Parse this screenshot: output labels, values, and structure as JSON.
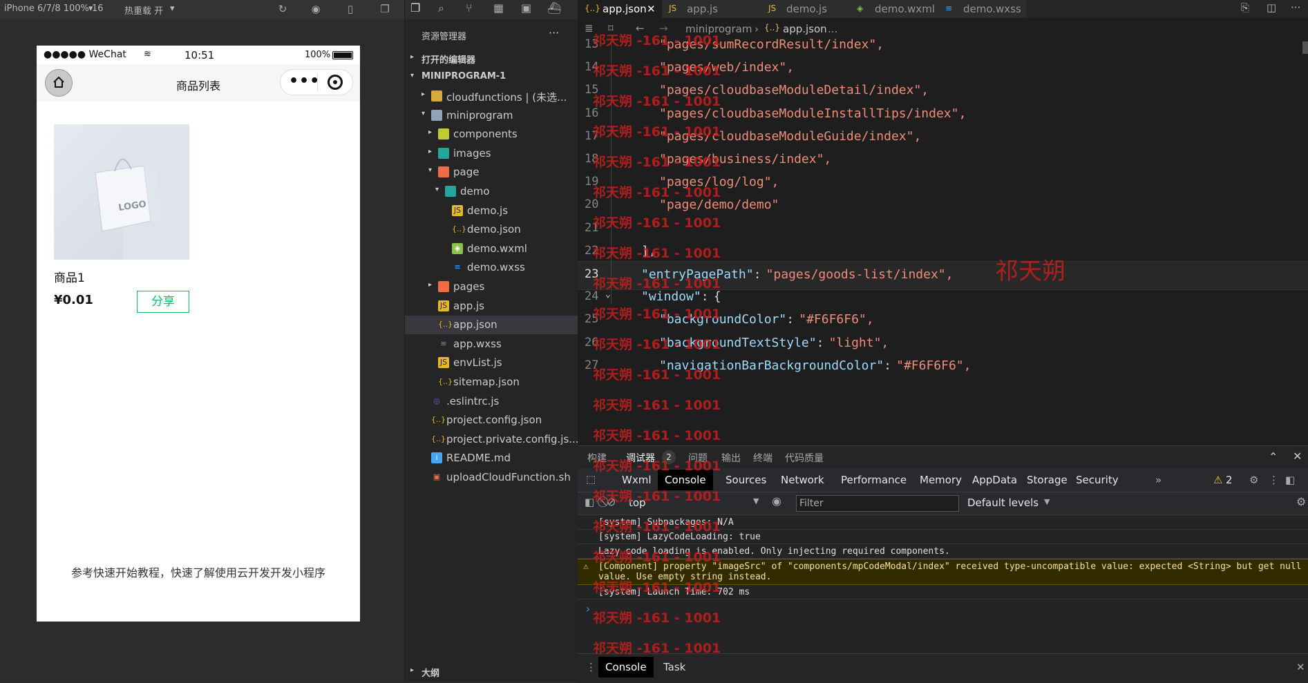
{
  "simulator_toolbar": {
    "device": "iPhone 6/7/8 100% 16",
    "hot_reload": "热重载 开"
  },
  "phone": {
    "carrier": "●●●●● WeChat",
    "time": "10:51",
    "battery": "100%",
    "nav_title": "商品列表",
    "capsule_dots": "•••",
    "product_name": "商品1",
    "product_price": "¥0.01",
    "share_label": "分享",
    "tip_text": "参考快速开始教程，快速了解使用云开发开发小程序",
    "logo_text": "LOGO"
  },
  "explorer": {
    "title": "资源管理器",
    "more": "···",
    "open_editors": "打开的编辑器",
    "project": "MINIPROGRAM-1",
    "outline": "大纲",
    "items": [
      {
        "label": "cloudfunctions | (未选...",
        "arrow": "▸",
        "icon": "folder-icon"
      },
      {
        "label": "miniprogram",
        "arrow": "▾",
        "icon": "folder-open-icon"
      },
      {
        "label": "components",
        "arrow": "▸",
        "icon": "folder-components-icon"
      },
      {
        "label": "images",
        "arrow": "▸",
        "icon": "folder-images-icon"
      },
      {
        "label": "page",
        "arrow": "▾",
        "icon": "folder-page-icon"
      },
      {
        "label": "demo",
        "arrow": "▾",
        "icon": "folder-demo-icon"
      },
      {
        "label": "demo.js",
        "arrow": "",
        "icon": "js-file-icon"
      },
      {
        "label": "demo.json",
        "arrow": "",
        "icon": "json-file-icon"
      },
      {
        "label": "demo.wxml",
        "arrow": "",
        "icon": "wxml-file-icon"
      },
      {
        "label": "demo.wxss",
        "arrow": "",
        "icon": "wxss-file-icon"
      },
      {
        "label": "pages",
        "arrow": "▸",
        "icon": "folder-pages-icon"
      },
      {
        "label": "app.js",
        "arrow": "",
        "icon": "js-file-icon"
      },
      {
        "label": "app.json",
        "arrow": "",
        "icon": "json-file-icon"
      },
      {
        "label": "app.wxss",
        "arrow": "",
        "icon": "wxss-file-icon"
      },
      {
        "label": "envList.js",
        "arrow": "",
        "icon": "js-file-icon"
      },
      {
        "label": "sitemap.json",
        "arrow": "",
        "icon": "json-file-icon"
      },
      {
        "label": ".eslintrc.js",
        "arrow": "",
        "icon": "eslint-file-icon"
      },
      {
        "label": "project.config.json",
        "arrow": "",
        "icon": "json-file-icon"
      },
      {
        "label": "project.private.config.js...",
        "arrow": "",
        "icon": "json-file-icon"
      },
      {
        "label": "README.md",
        "arrow": "",
        "icon": "info-file-icon"
      },
      {
        "label": "uploadCloudFunction.sh",
        "arrow": "",
        "icon": "shell-file-icon"
      }
    ]
  },
  "editor": {
    "tabs": [
      {
        "label": "app.json",
        "icon": "{..}"
      },
      {
        "label": "app.js",
        "icon": "JS"
      },
      {
        "label": "demo.js",
        "icon": "JS"
      },
      {
        "label": "demo.wxml",
        "icon": "◈"
      },
      {
        "label": "demo.wxss",
        "icon": "≡"
      }
    ],
    "breadcrumb_folder": "miniprogram",
    "breadcrumb_file": "app.json",
    "breadcrumb_more": "...",
    "lines": [
      {
        "no": "13",
        "text": "\"pages/sumRecordResult/index\",",
        "indent": 1
      },
      {
        "no": "14",
        "text": "\"pages/web/index\",",
        "indent": 1
      },
      {
        "no": "15",
        "text": "\"pages/cloudbaseModuleDetail/index\",",
        "indent": 1
      },
      {
        "no": "16",
        "text": "\"pages/cloudbaseModuleInstallTips/index\",",
        "indent": 1
      },
      {
        "no": "17",
        "text": "\"pages/cloudbaseModuleGuide/index\",",
        "indent": 1
      },
      {
        "no": "18",
        "text": "\"pages/business/index\",",
        "indent": 1
      },
      {
        "no": "19",
        "text": "\"pages/log/log\",",
        "indent": 1
      },
      {
        "no": "20",
        "text": "\"page/demo/demo\"",
        "indent": 1
      },
      {
        "no": "21",
        "text": "",
        "indent": 0
      },
      {
        "no": "22",
        "text": "],",
        "indent": 0
      },
      {
        "no": "23",
        "key": "\"entryPagePath\"",
        "value": "\"pages/goods-list/index\",",
        "indent": 0
      },
      {
        "no": "24",
        "key": "\"window\"",
        "value": "{",
        "indent": 0
      },
      {
        "no": "25",
        "key": "\"backgroundColor\"",
        "value": "\"#F6F6F6\",",
        "indent": 1
      },
      {
        "no": "26",
        "key": "\"backgroundTextStyle\"",
        "value": "\"light\",",
        "indent": 1
      },
      {
        "no": "27",
        "key": "\"navigationBarBackgroundColor\"",
        "value": "\"#F6F6F6\",",
        "indent": 1
      }
    ],
    "watermark_big": "祁天朔",
    "watermark_small": "祁天朔 -161 - 1001"
  },
  "debug": {
    "top_tabs": [
      "构建",
      "调试器",
      "问题",
      "输出",
      "终端",
      "代码质量"
    ],
    "debugger_badge": "2",
    "devtools_tabs": [
      "Wxml",
      "Console",
      "Sources",
      "Network",
      "Performance",
      "Memory",
      "AppData",
      "Storage",
      "Security"
    ],
    "more_tabs": "»",
    "warning_count": "2",
    "context": "top",
    "filter_placeholder": "Filter",
    "levels": "Default levels",
    "logs": [
      {
        "text": "[system] Subpackages: N/A",
        "type": "info"
      },
      {
        "text": "[system] LazyCodeLoading: true",
        "type": "info"
      },
      {
        "text": "Lazy code loading is enabled. Only injecting required components.",
        "type": "info"
      },
      {
        "text": "[Component] property \"imageSrc\" of \"components/mpCodeModal/index\" received type-uncompatible value: expected <String> but get null value. Use empty string instead.",
        "type": "warn"
      },
      {
        "text": "[system] Launch Time: 702 ms",
        "type": "info"
      }
    ],
    "prompt": "›",
    "bottom_tabs": [
      "Console",
      "Task"
    ]
  }
}
